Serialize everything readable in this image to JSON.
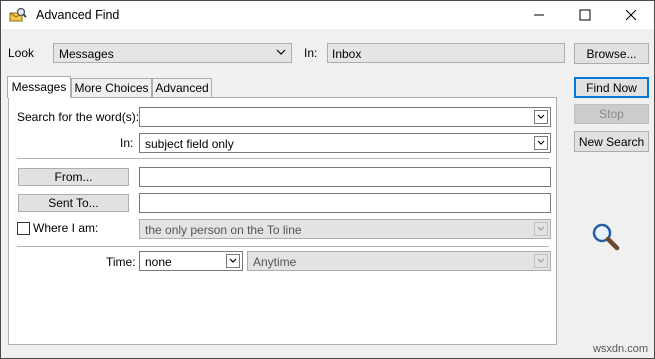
{
  "window": {
    "title": "Advanced Find"
  },
  "look": {
    "label": "Look",
    "value": "Messages",
    "in_label": "In:",
    "in_value": "Inbox"
  },
  "buttons": {
    "browse": "Browse...",
    "find_now": "Find Now",
    "stop": "Stop",
    "new_search": "New Search"
  },
  "tabs": [
    "Messages",
    "More Choices",
    "Advanced"
  ],
  "messages": {
    "search_words_label": "Search for the word(s):",
    "search_words_value": "",
    "in_label": "In:",
    "in_value": "subject field only",
    "from_button": "From...",
    "from_value": "",
    "sent_to_button": "Sent To...",
    "sent_to_value": "",
    "where_label": "Where I am:",
    "where_checked": false,
    "where_value": "the only person on the To line",
    "time_label": "Time:",
    "time_value": "none",
    "time_range_value": "Anytime"
  },
  "watermark": "wsxdn.com",
  "icons": {
    "app": "advanced-find-app-icon",
    "search": "magnifier-icon"
  }
}
